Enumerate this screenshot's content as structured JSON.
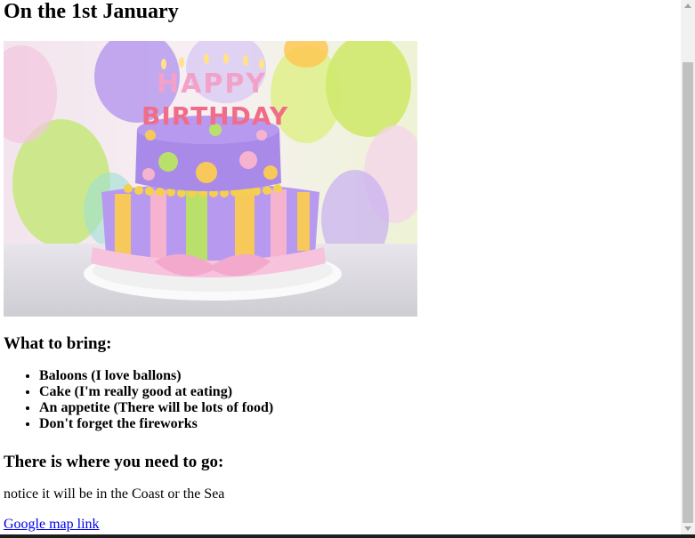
{
  "heading": "On the 1st January",
  "image": {
    "alt": "birthday-cake-photo",
    "cake_text_line1": "HAPPY",
    "cake_text_line2": "BIRTHDAY"
  },
  "bring_section": {
    "title": "What to bring:",
    "items": [
      "Baloons (I love ballons)",
      "Cake (I'm really good at eating)",
      "An appetite (There will be lots of food)",
      "Don't forget the fireworks"
    ]
  },
  "location_section": {
    "title": "There is where you need to go:",
    "note": "notice it will be in the Coast or the Sea",
    "link_text": "Google map link"
  },
  "colors": {
    "link": "#0000ee",
    "scrollbar_track": "#f1f1f1",
    "scrollbar_thumb": "#c1c1c1"
  }
}
